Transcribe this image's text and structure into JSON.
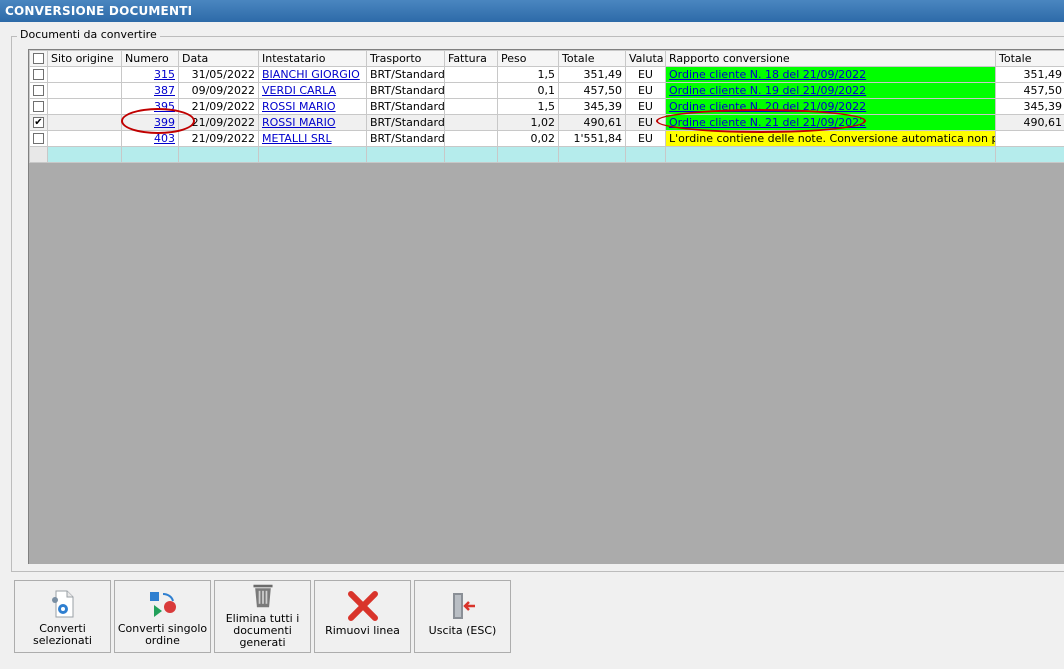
{
  "window": {
    "title": "CONVERSIONE DOCUMENTI"
  },
  "group": {
    "label": "Documenti da convertire"
  },
  "grid": {
    "columns": [
      "Sito origine",
      "Numero",
      "Data",
      "Intestatario",
      "Trasporto",
      "Fattura",
      "Peso",
      "Totale",
      "Valuta",
      "Rapporto conversione",
      "Totale"
    ],
    "rows": [
      {
        "checked": "",
        "sito": "",
        "numero": "315",
        "data": "31/05/2022",
        "intestatario": "BIANCHI GIORGIO",
        "trasporto": "BRT/Standard",
        "fattura": "",
        "peso": "1,5",
        "totale": "351,49",
        "valuta": "EU",
        "rapporto": "Ordine cliente N. 18 del 21/09/2022",
        "totale2": "351,49",
        "status": "ok"
      },
      {
        "checked": "",
        "sito": "",
        "numero": "387",
        "data": "09/09/2022",
        "intestatario": "VERDI CARLA",
        "trasporto": "BRT/Standard",
        "fattura": "",
        "peso": "0,1",
        "totale": "457,50",
        "valuta": "EU",
        "rapporto": "Ordine cliente N. 19 del 21/09/2022",
        "totale2": "457,50",
        "status": "ok"
      },
      {
        "checked": "",
        "sito": "",
        "numero": "395",
        "data": "21/09/2022",
        "intestatario": "ROSSI MARIO",
        "trasporto": "BRT/Standard",
        "fattura": "",
        "peso": "1,5",
        "totale": "345,39",
        "valuta": "EU",
        "rapporto": "Ordine cliente N. 20 del 21/09/2022",
        "totale2": "345,39",
        "status": "ok"
      },
      {
        "checked": "✔",
        "sito": "",
        "numero": "399",
        "data": "21/09/2022",
        "intestatario": "ROSSI MARIO",
        "trasporto": "BRT/Standard",
        "fattura": "",
        "peso": "1,02",
        "totale": "490,61",
        "valuta": "EU",
        "rapporto": "Ordine cliente N. 21 del 21/09/2022",
        "totale2": "490,61",
        "status": "ok"
      },
      {
        "checked": "",
        "sito": "",
        "numero": "403",
        "data": "21/09/2022",
        "intestatario": "METALLI SRL",
        "trasporto": "BRT/Standard",
        "fattura": "",
        "peso": "0,02",
        "totale": "1'551,84",
        "valuta": "EU",
        "rapporto": "L'ordine contiene delle note. Conversione automatica non possibile.",
        "totale2": "",
        "status": "warn"
      }
    ]
  },
  "buttons": {
    "convert_selected": "Converti selezionati",
    "convert_single": "Converti singolo ordine",
    "delete_all": "Elimina tutti i documenti generati",
    "remove_line": "Rimuovi linea",
    "exit": "Uscita (ESC)"
  },
  "colors": {
    "success": "#00ff00",
    "warning": "#ffff00",
    "new_row": "#b5ecec",
    "annotation": "#c00000",
    "link": "#0000cc"
  },
  "icons": [
    "gear-document-icon",
    "convert-shapes-icon",
    "trash-icon",
    "red-x-icon",
    "exit-door-icon"
  ]
}
